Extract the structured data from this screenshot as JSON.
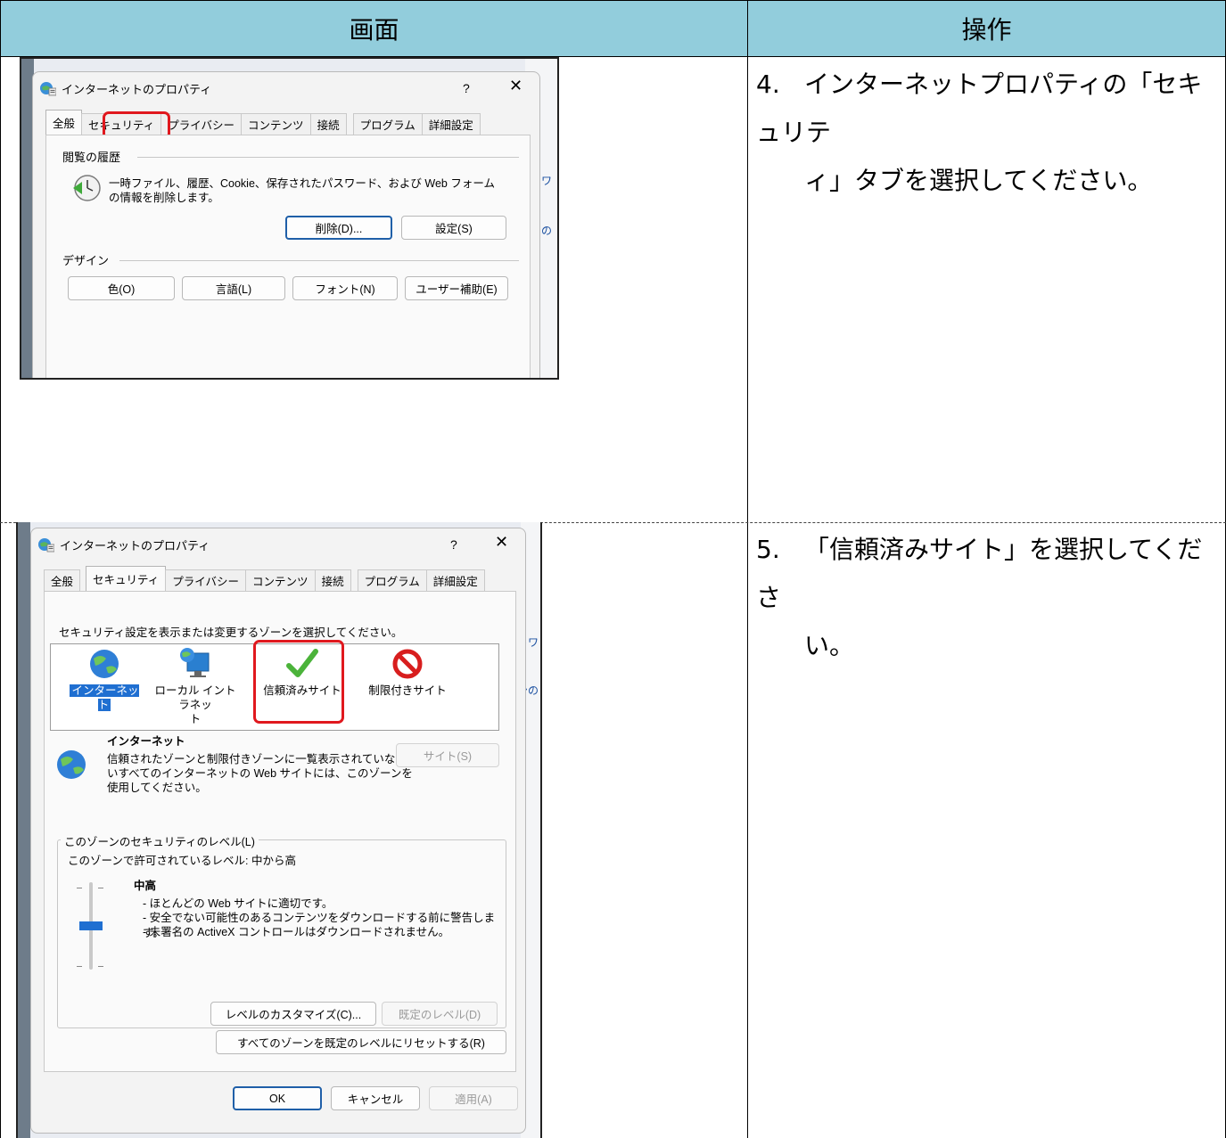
{
  "table": {
    "header_screen": "画面",
    "header_operation": "操作"
  },
  "steps": [
    {
      "number": "4.",
      "line1": "インターネットプロパティの「セキュリテ",
      "line2": "ィ」タブを選択してください。"
    },
    {
      "number": "5.",
      "line1": "「信頼済みサイト」を選択してくださ",
      "line2": "い。"
    }
  ],
  "dialog": {
    "title": "インターネットのプロパティ",
    "help": "?",
    "close": "✕",
    "tabs": [
      "全般",
      "セキュリティ",
      "プライバシー",
      "コンテンツ",
      "接続",
      "プログラム",
      "詳細設定"
    ]
  },
  "general": {
    "history_group": "閲覧の履歴",
    "history_text1": "一時ファイル、履歴、Cookie、保存されたパスワード、および Web フォーム",
    "history_text2": "の情報を削除します。",
    "delete_button": "削除(D)...",
    "settings_button": "設定(S)",
    "design_group": "デザイン",
    "color_button": "色(O)",
    "language_button": "言語(L)",
    "font_button": "フォント(N)",
    "accessibility_button": "ユーザー補助(E)"
  },
  "security": {
    "zone_prompt": "セキュリティ設定を表示または変更するゾーンを選択してください。",
    "zones": [
      {
        "label": "インターネット",
        "icon": "globe-icon"
      },
      {
        "label_line1": "ローカル イントラネッ",
        "label_line2": "ト",
        "icon": "intranet-icon"
      },
      {
        "label": "信頼済みサイト",
        "icon": "checkmark-icon"
      },
      {
        "label": "制限付きサイト",
        "icon": "prohibited-icon"
      }
    ],
    "zone_name": "インターネット",
    "zone_desc1": "信頼されたゾーンと制限付きゾーンに一覧表示されていな",
    "zone_desc2": "いすべてのインターネットの Web サイトには、このゾーンを",
    "zone_desc3": "使用してください。",
    "sites_button": "サイト(S)",
    "level_group": "このゾーンのセキュリティのレベル(L)",
    "allowed_levels": "このゾーンで許可されているレベル: 中から高",
    "level_name": "中高",
    "level_bullet1": "- ほとんどの Web サイトに適切です。",
    "level_bullet2": "- 安全でない可能性のあるコンテンツをダウンロードする前に警告します。",
    "level_bullet3": "- 未署名の ActiveX コントロールはダウンロードされません。",
    "custom_level_button": "レベルのカスタマイズ(C)...",
    "default_level_button": "既定のレベル(D)",
    "reset_all_button": "すべてのゾーンを既定のレベルにリセットする(R)",
    "ok_button": "OK",
    "cancel_button": "キャンセル",
    "apply_button": "適用(A)"
  },
  "background": {
    "frag1": "トワ",
    "frag2": "ンの"
  },
  "colors": {
    "header_bg": "#92cddc",
    "highlight": "#e0181e",
    "selection": "#1f6fd1"
  }
}
